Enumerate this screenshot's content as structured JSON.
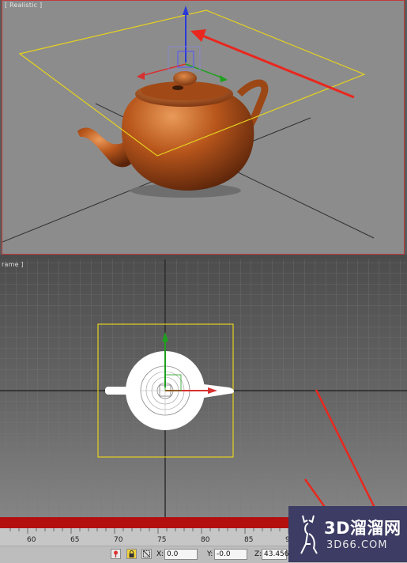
{
  "viewports": {
    "perspective": {
      "label": "[ Realistic ]"
    },
    "top": {
      "label": "rame ]"
    }
  },
  "ruler": {
    "ticks": [
      "60",
      "65",
      "70",
      "75",
      "80",
      "85",
      "90"
    ]
  },
  "status": {
    "x_label": "X:",
    "x_value": "0.0",
    "y_label": "Y:",
    "y_value": "-0.0",
    "z_label": "Z:",
    "z_value": "43.456"
  },
  "watermark": {
    "brand": "3D溜溜网",
    "url": "3D66.COM"
  },
  "colors": {
    "accent_red": "#e8281e",
    "selection_yellow": "#e6d21e",
    "teapot": "#b8561c",
    "viewport_border": "#c23a3a"
  },
  "icons": [
    "move-gizmo-icon",
    "lock-icon",
    "selection-icon",
    "deer-logo-icon"
  ]
}
